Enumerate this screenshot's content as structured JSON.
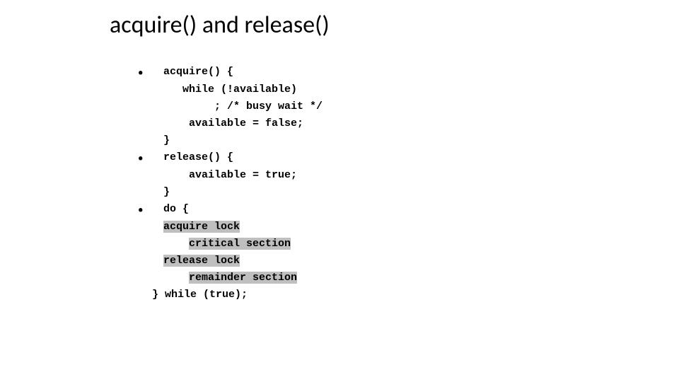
{
  "title": "acquire() and release()",
  "bullets": {
    "b1": "•",
    "b2": "•",
    "b3": "•"
  },
  "code": {
    "l1": "acquire() {",
    "l2": "   while (!available)",
    "l3": "; /* busy wait */",
    "l4": "available = false;",
    "l5": "}",
    "l6": "release() {",
    "l7": "available = true;",
    "l8": "}",
    "l9": "do {",
    "l10a": "acquire lock",
    "l11a": "critical section",
    "l12a": "release lock",
    "l13a": "remainder section",
    "l14": "} while (true);"
  }
}
